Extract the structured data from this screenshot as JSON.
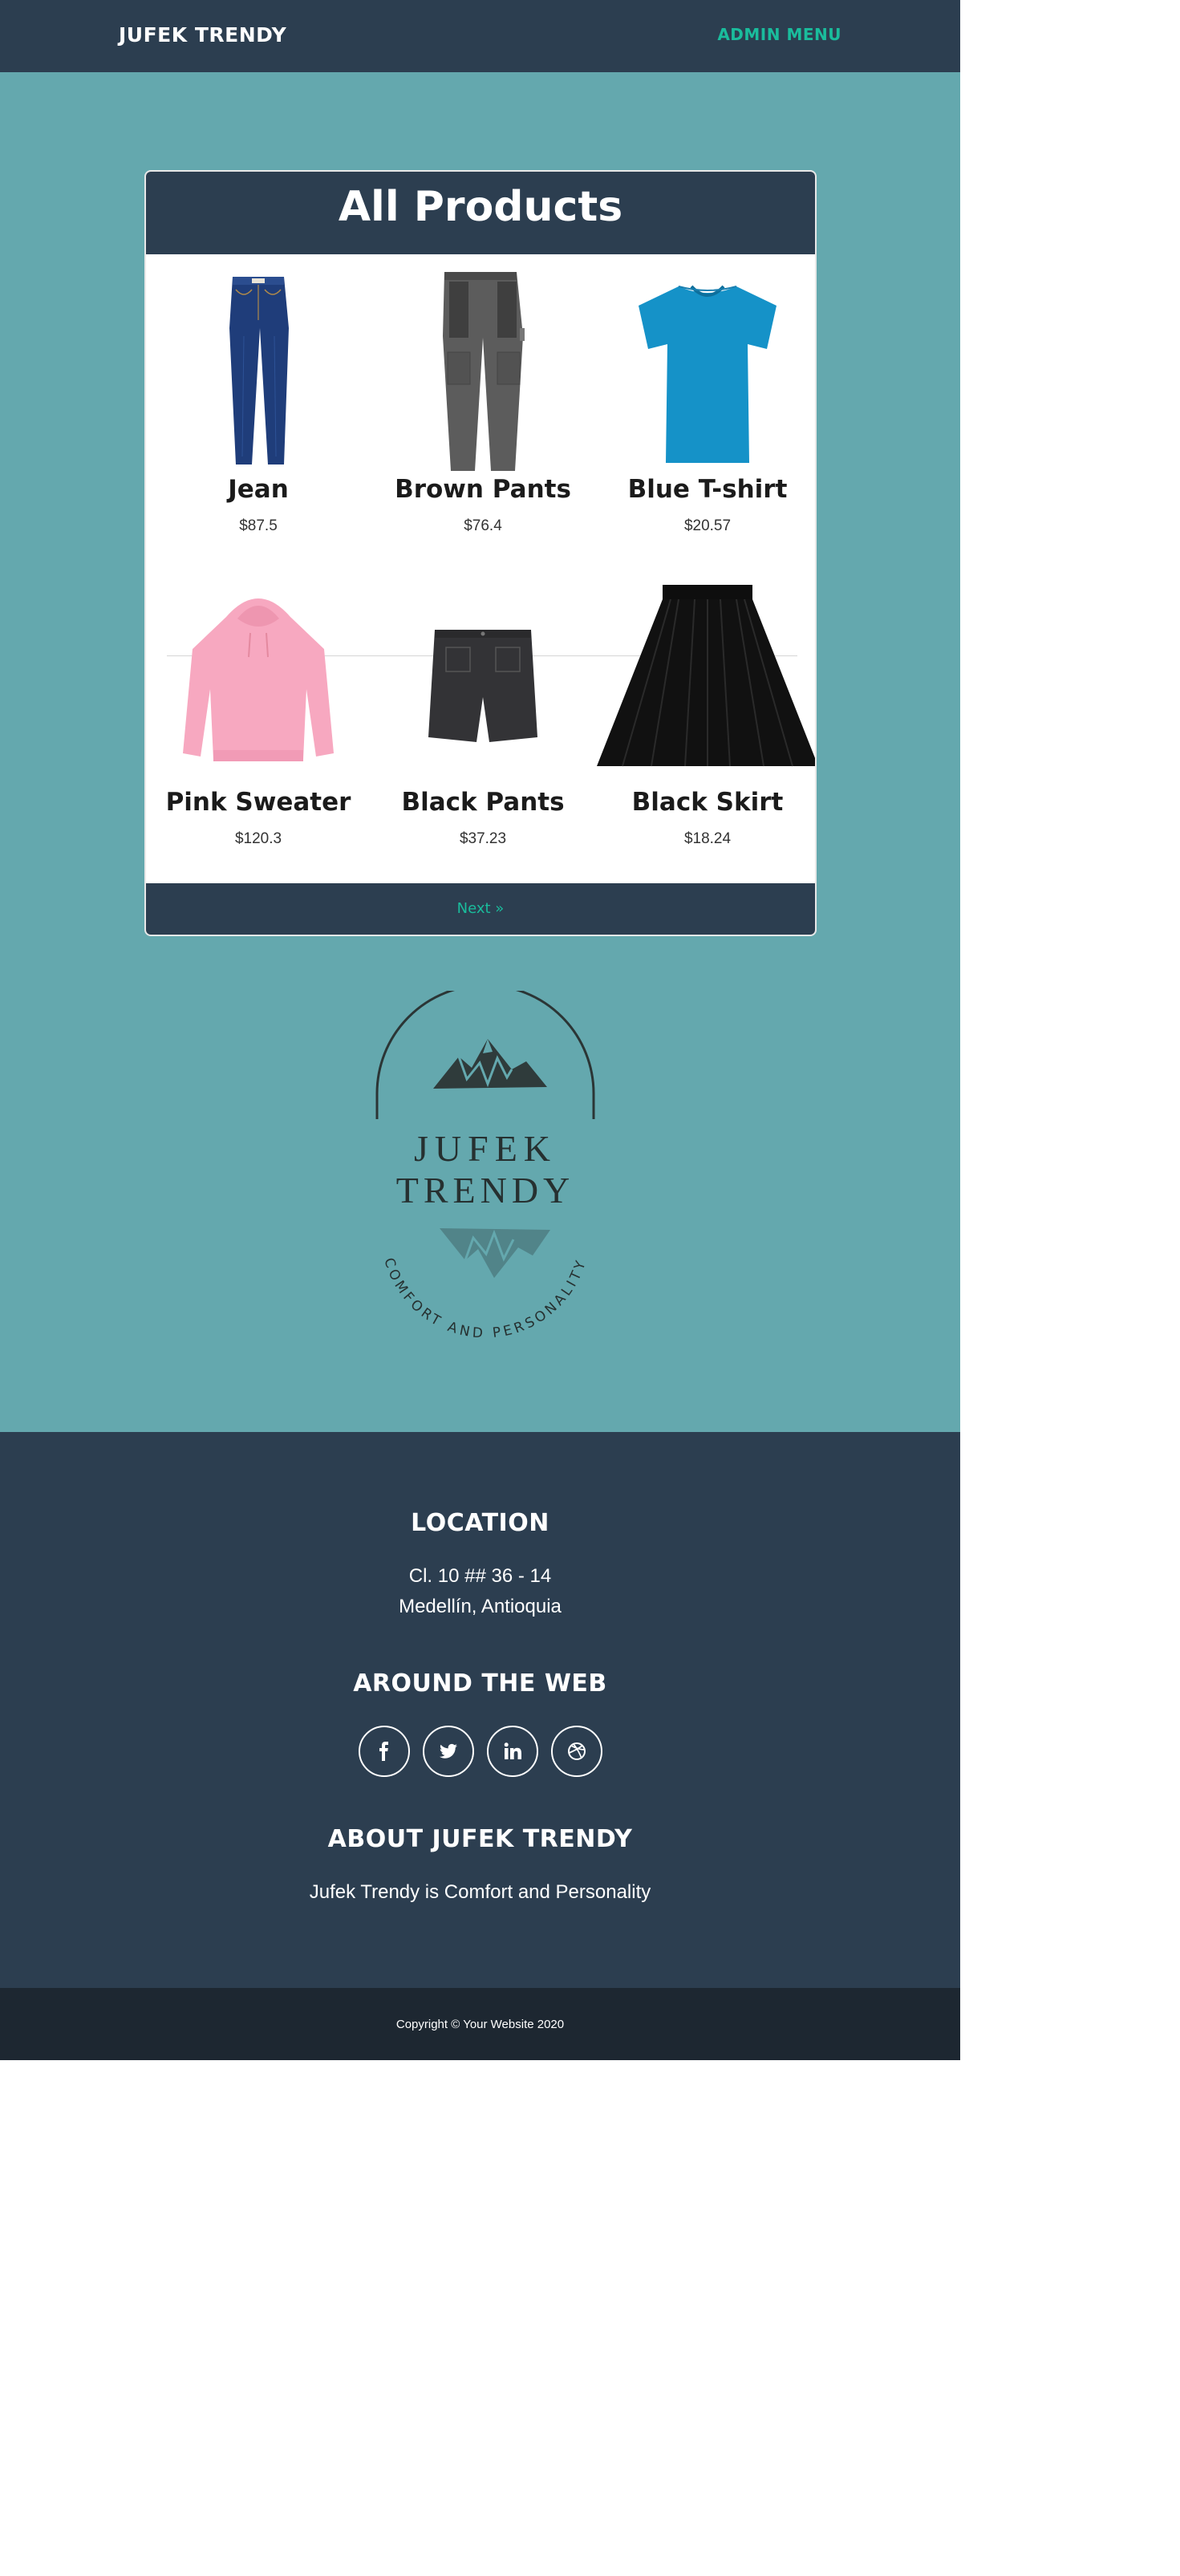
{
  "navbar": {
    "brand": "JUFEK TRENDY",
    "admin_label": "ADMIN MENU"
  },
  "products_card": {
    "title": "All Products",
    "products": [
      {
        "name": "Jean",
        "price": "$87.5"
      },
      {
        "name": "Brown Pants",
        "price": "$76.4"
      },
      {
        "name": "Blue T-shirt",
        "price": "$20.57"
      },
      {
        "name": "Pink Sweater",
        "price": "$120.3"
      },
      {
        "name": "Black Pants",
        "price": "$37.23"
      },
      {
        "name": "Black Skirt",
        "price": "$18.24"
      }
    ],
    "next_label": "Next »"
  },
  "logo": {
    "line1": "JUFEK",
    "line2": "TRENDY",
    "tagline": "COMFORT AND PERSONALITY"
  },
  "footer": {
    "location_heading": "LOCATION",
    "address_line1": "Cl. 10 ## 36 - 14",
    "address_line2": "Medellín, Antioquia",
    "web_heading": "AROUND THE WEB",
    "social_icons": [
      "facebook-icon",
      "twitter-icon",
      "linkedin-icon",
      "dribbble-icon"
    ],
    "about_heading": "ABOUT JUFEK TRENDY",
    "about_text": "Jufek Trendy is Comfort and Personality",
    "copyright": "Copyright © Your Website 2020"
  },
  "colors": {
    "navy": "#2c3e50",
    "teal": "#64a8ae",
    "accent": "#1abc9c",
    "dark": "#1d2731"
  }
}
